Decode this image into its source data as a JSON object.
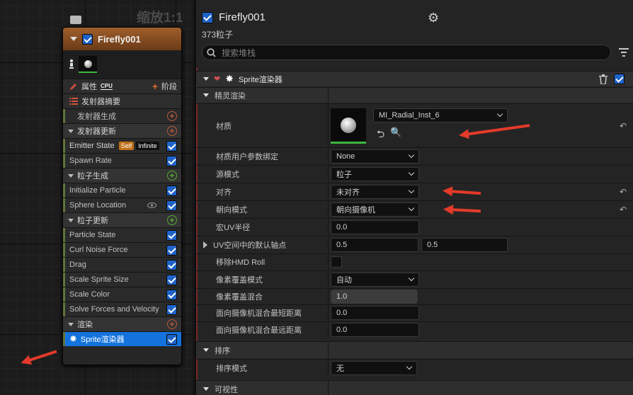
{
  "graph": {
    "zoom": "缩放1:1"
  },
  "node": {
    "title": "Firefly001",
    "props_label": "属性",
    "cpu_label": "CPU",
    "stage_label": "阶段",
    "summary_label": "发射器摘要",
    "sections": {
      "emitter_spawn": "发射器生成",
      "emitter_update": "发射器更新",
      "particle_spawn": "粒子生成",
      "particle_update": "粒子更新",
      "render": "渲染"
    },
    "items": {
      "emitter_state": "Emitter State",
      "badge_self": "Self",
      "badge_infinite": "Infinite",
      "spawn_rate": "Spawn Rate",
      "initialize_particle": "Initialize Particle",
      "sphere_location": "Sphere Location",
      "particle_state": "Particle State",
      "curl_noise_force": "Curl Noise Force",
      "drag": "Drag",
      "scale_sprite_size": "Scale Sprite Size",
      "scale_color": "Scale Color",
      "solve_forces": "Solve Forces and Velocity",
      "sprite_renderer": "Sprite渲染器"
    }
  },
  "details": {
    "title": "Firefly001",
    "subtitle": "373粒子",
    "search_placeholder": "搜索堆栈",
    "header_title": "Sprite渲染器",
    "sec_sprite": "精灵渲染",
    "rows": {
      "material": "材质",
      "material_value": "MI_Radial_Inst_6",
      "mat_param_binding": "材质用户参数绑定",
      "mat_param_value": "None",
      "source_mode": "源模式",
      "source_mode_value": "粒子",
      "alignment": "对齐",
      "alignment_value": "未对齐",
      "facing_mode": "朝向模式",
      "facing_mode_value": "朝向摄像机",
      "macro_uv_radius": "宏UV半径",
      "macro_uv_value": "0.0",
      "pivot": "UV空间中的默认轴点",
      "pivot_x": "0.5",
      "pivot_y": "0.5",
      "remove_hmd_roll": "移除HMD Roll",
      "pixel_coverage_mode": "像素覆盖模式",
      "pixel_coverage_mode_value": "自动",
      "pixel_coverage_blend": "像素覆盖混合",
      "pixel_coverage_blend_value": "1.0",
      "min_dist": "面向摄像机混合最短距离",
      "min_dist_value": "0.0",
      "max_dist": "面向摄像机混合最远距离",
      "max_dist_value": "0.0"
    },
    "sec_sort": "排序",
    "sort_mode": "排序模式",
    "sort_mode_value": "无",
    "sec_visibility": "可视性"
  },
  "colors": {
    "accent": "#1472dc",
    "annotation": "#e43a2a",
    "module_green": "#60753a"
  }
}
